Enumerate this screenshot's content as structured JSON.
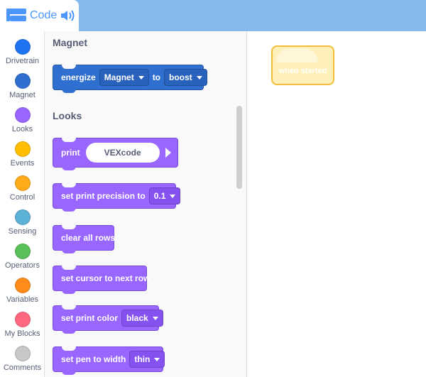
{
  "tab": {
    "label": "Code",
    "accent": "#4c97ff"
  },
  "categories": [
    {
      "label": "Drivetrain",
      "color": "#1e73f0"
    },
    {
      "label": "Magnet",
      "color": "#2f6fcf"
    },
    {
      "label": "Looks",
      "color": "#9966ff"
    },
    {
      "label": "Events",
      "color": "#ffbf00"
    },
    {
      "label": "Control",
      "color": "#ffab19"
    },
    {
      "label": "Sensing",
      "color": "#5cb1d6"
    },
    {
      "label": "Operators",
      "color": "#59c059"
    },
    {
      "label": "Variables",
      "color": "#ff8c1a"
    },
    {
      "label": "My Blocks",
      "color": "#ff6680"
    },
    {
      "label": "Comments",
      "color": "#c8c8c8"
    }
  ],
  "flyout": {
    "magnet_title": "Magnet",
    "looks_title": "Looks",
    "energize": {
      "word": "energize",
      "device": "Magnet",
      "to": "to",
      "mode": "boost"
    },
    "print": {
      "word": "print",
      "value": "VEXcode"
    },
    "precision": {
      "word": "set print precision to",
      "value": "0.1"
    },
    "clear_rows": "clear all rows",
    "next_row": "set cursor to next row",
    "print_color": {
      "word": "set print color",
      "value": "black"
    },
    "pen_width": {
      "word": "set pen to width",
      "value": "thin"
    }
  },
  "canvas": {
    "hat_label": "when started"
  }
}
